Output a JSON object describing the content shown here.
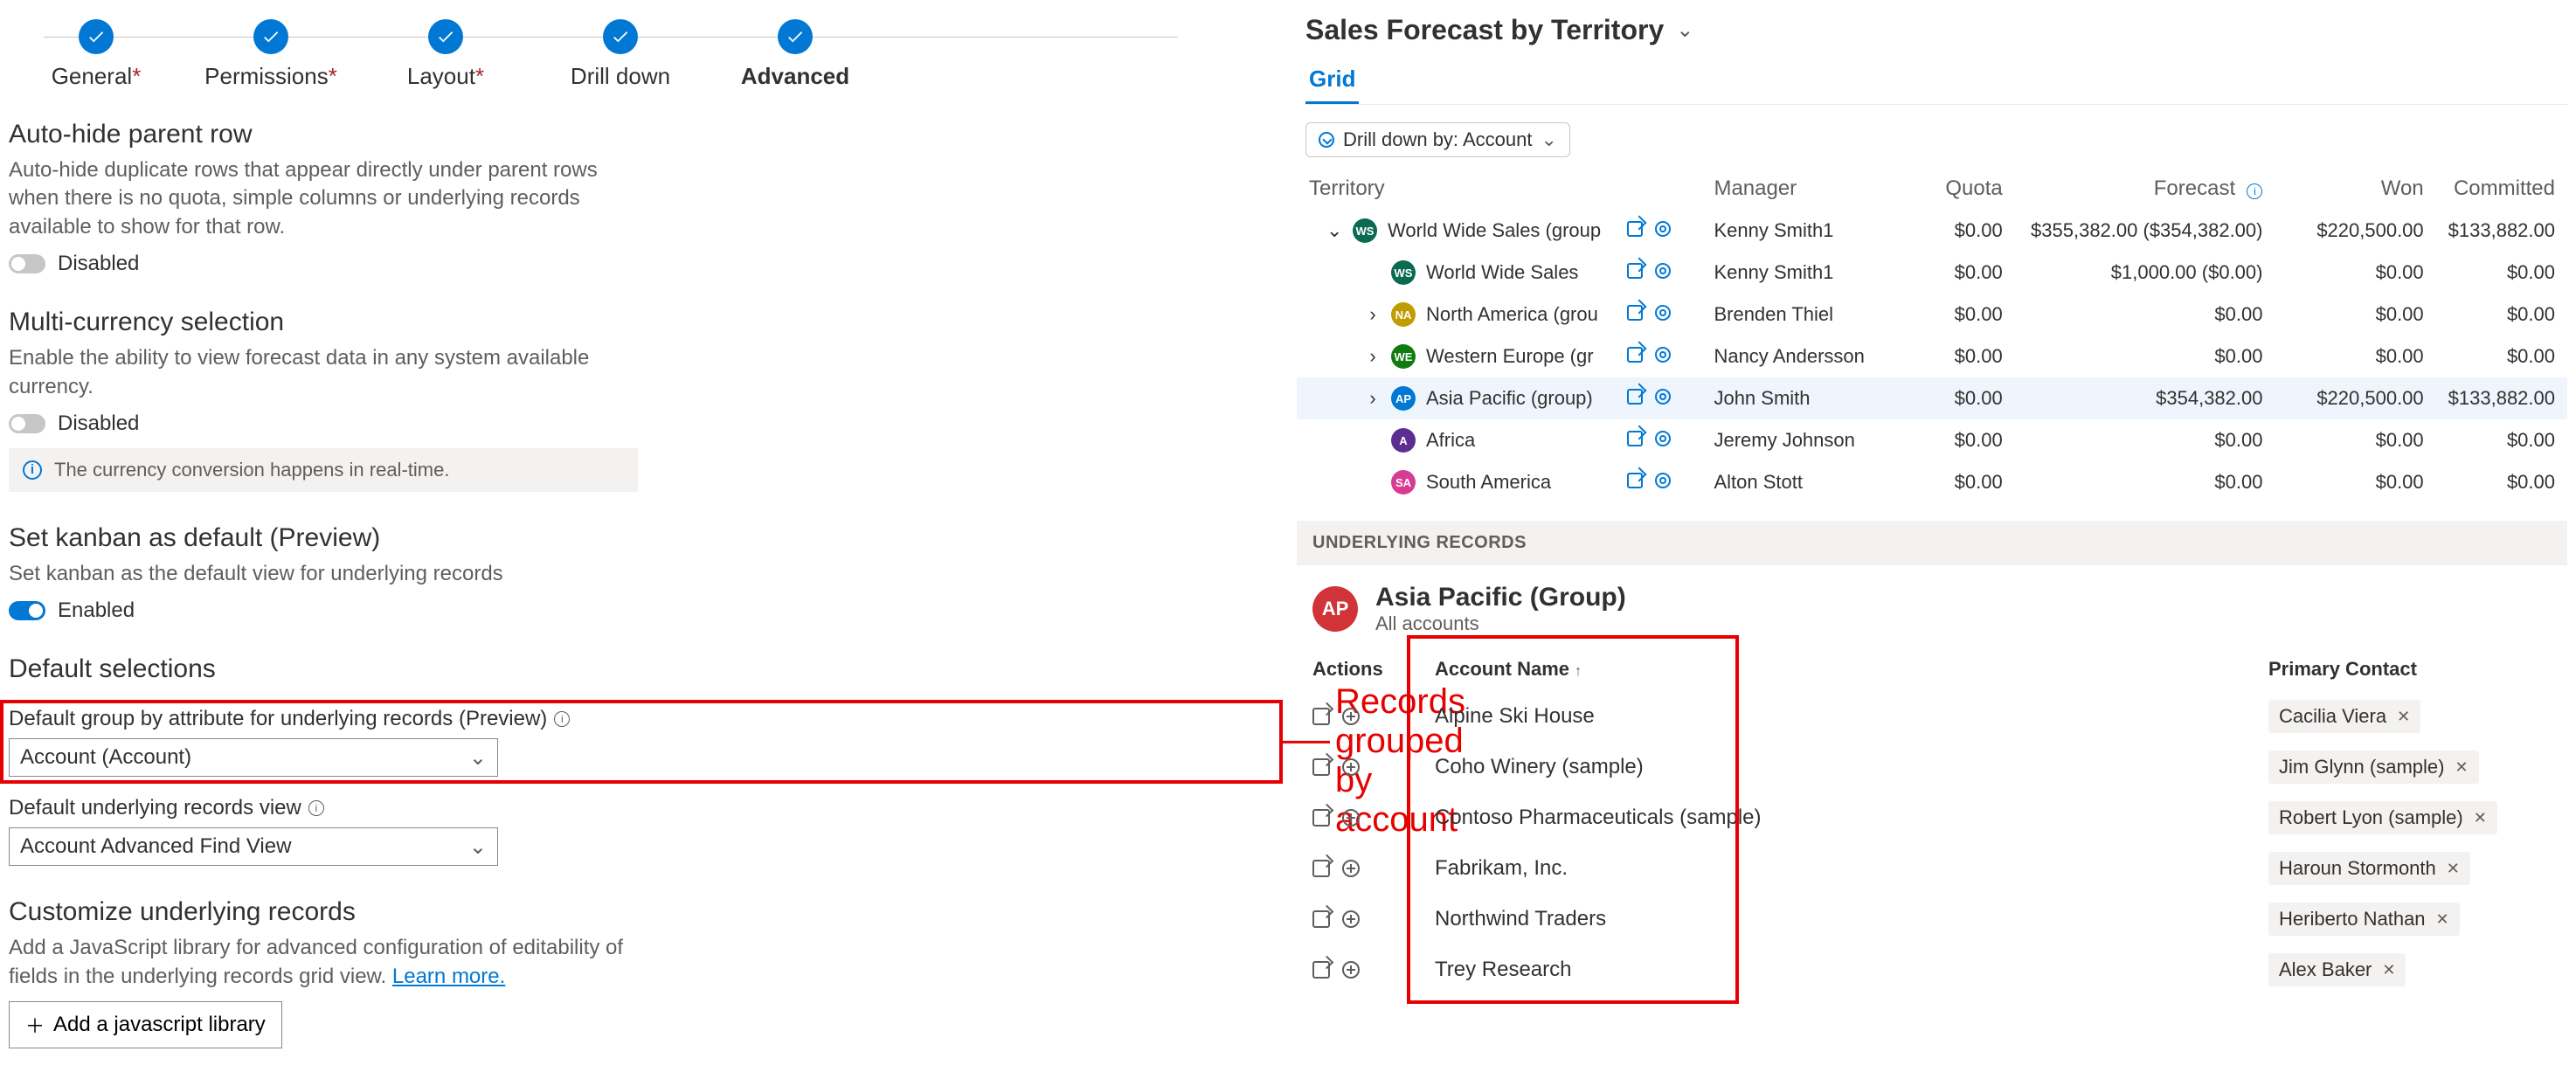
{
  "wizard": {
    "steps": [
      {
        "label": "General",
        "required": true
      },
      {
        "label": "Permissions",
        "required": true
      },
      {
        "label": "Layout",
        "required": true
      },
      {
        "label": "Drill down",
        "required": false
      },
      {
        "label": "Advanced",
        "required": false
      }
    ],
    "active_idx": 4
  },
  "sections": {
    "autohide": {
      "title": "Auto-hide parent row",
      "desc": "Auto-hide duplicate rows that appear directly under parent rows when there is no quota, simple columns or underlying records available to show for that row.",
      "state": "Disabled"
    },
    "multicurrency": {
      "title": "Multi-currency selection",
      "desc": "Enable the ability to view forecast data in any system available currency.",
      "state": "Disabled",
      "banner": "The currency conversion happens in real-time."
    },
    "kanban": {
      "title": "Set kanban as default (Preview)",
      "desc": "Set kanban as the default view for underlying records",
      "state": "Enabled"
    },
    "defaults": {
      "title": "Default selections",
      "group_label": "Default group by attribute for underlying records (Preview)",
      "group_value": "Account (Account)",
      "view_label": "Default underlying records view",
      "view_value": "Account Advanced Find View"
    },
    "customize": {
      "title": "Customize underlying records",
      "desc_a": "Add a JavaScript library for advanced configuration of editability of fields in the underlying records grid view. ",
      "learn": "Learn more.",
      "button": "Add a javascript library"
    }
  },
  "annotation_label": "Records grouped by account",
  "forecast": {
    "title": "Sales Forecast by Territory",
    "tab": "Grid",
    "drill": "Drill down by: Account",
    "columns": [
      "Territory",
      "",
      "Manager",
      "Quota",
      "Forecast",
      "Won",
      "Committed"
    ],
    "rows": [
      {
        "indent": 0,
        "exp": "down",
        "badge": "WS",
        "bclass": "b-ws",
        "name": "World Wide Sales (group",
        "mgr": "Kenny Smith1",
        "quota": "$0.00",
        "forecast": "$355,382.00  ($354,382.00)",
        "won": "$220,500.00",
        "committed": "$133,882.00"
      },
      {
        "indent": 1,
        "exp": "",
        "badge": "WS",
        "bclass": "b-ws",
        "name": "World Wide Sales",
        "mgr": "Kenny Smith1",
        "quota": "$0.00",
        "forecast": "$1,000.00  ($0.00)",
        "won": "$0.00",
        "committed": "$0.00"
      },
      {
        "indent": 1,
        "exp": "right",
        "badge": "NA",
        "bclass": "b-na",
        "name": "North America (grou",
        "mgr": "Brenden Thiel",
        "quota": "$0.00",
        "forecast": "$0.00",
        "won": "$0.00",
        "committed": "$0.00"
      },
      {
        "indent": 1,
        "exp": "right",
        "badge": "WE",
        "bclass": "b-we",
        "name": "Western Europe (gr",
        "mgr": "Nancy Andersson",
        "quota": "$0.00",
        "forecast": "$0.00",
        "won": "$0.00",
        "committed": "$0.00"
      },
      {
        "indent": 1,
        "exp": "right",
        "badge": "AP",
        "bclass": "b-ap",
        "name": "Asia Pacific (group)",
        "mgr": "John Smith",
        "quota": "$0.00",
        "forecast": "$354,382.00",
        "won": "$220,500.00",
        "committed": "$133,882.00",
        "selected": true
      },
      {
        "indent": 1,
        "exp": "",
        "badge": "A",
        "bclass": "b-af",
        "name": "Africa",
        "mgr": "Jeremy Johnson",
        "quota": "$0.00",
        "forecast": "$0.00",
        "won": "$0.00",
        "committed": "$0.00"
      },
      {
        "indent": 1,
        "exp": "",
        "badge": "SA",
        "bclass": "b-sa",
        "name": "South America",
        "mgr": "Alton Stott",
        "quota": "$0.00",
        "forecast": "$0.00",
        "won": "$0.00",
        "committed": "$0.00"
      }
    ]
  },
  "underlying": {
    "header": "UNDERLYING RECORDS",
    "badge": "AP",
    "name": "Asia Pacific (Group)",
    "sub": "All accounts",
    "col_actions": "Actions",
    "col_account": "Account Name",
    "col_contact": "Primary Contact",
    "rows": [
      {
        "name": "Alpine Ski House",
        "contact": "Cacilia Viera"
      },
      {
        "name": "Coho Winery (sample)",
        "contact": "Jim Glynn (sample)"
      },
      {
        "name": "Contoso Pharmaceuticals (sample)",
        "contact": "Robert Lyon (sample)"
      },
      {
        "name": "Fabrikam, Inc.",
        "contact": "Haroun Stormonth"
      },
      {
        "name": "Northwind Traders",
        "contact": "Heriberto Nathan"
      },
      {
        "name": "Trey Research",
        "contact": "Alex Baker"
      }
    ]
  }
}
